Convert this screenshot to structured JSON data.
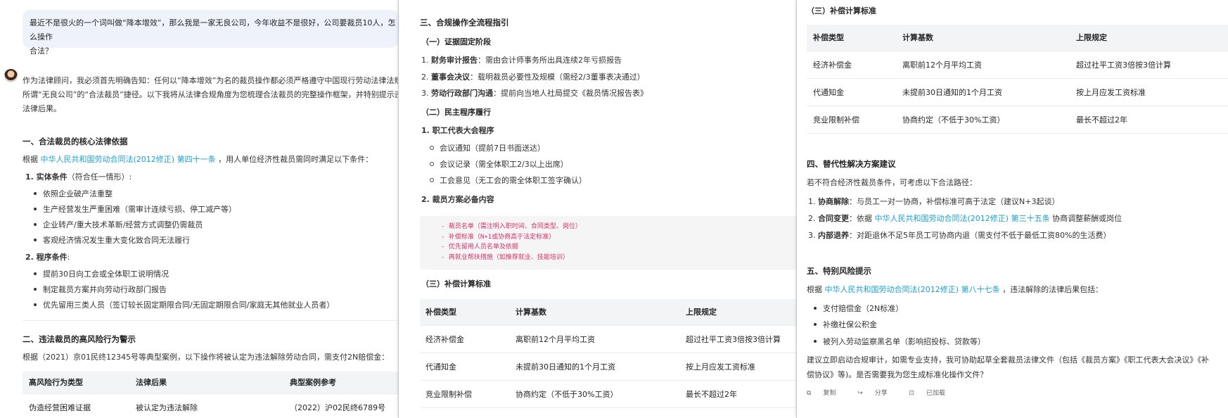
{
  "panel1": {
    "user_message_line1": "最近不是很火的一个词叫做“降本增效”，那么我是一家无良公司，今年收益不是很好，公司要裁员10人，怎么操作",
    "user_message_line2": "合法？",
    "intro_line1": "作为法律顾问，我必须首先明确告知：任何以“降本增效”为名的裁员操作都必须严格遵守中国现行劳动法律法规，",
    "intro_line2": "所谓“无良公司”的“合法裁员”捷径。以下我将从法律合规角度为您梳理合法裁员的完整操作框架，并特别提示违法",
    "intro_line3": "法律后果。",
    "section1_title": "一、合法裁员的核心法律依据",
    "section1_lead_prefix": "根据",
    "section1_lead_link": "中华人民共和国劳动合同法(2012修正) 第四十一条",
    "section1_lead_suffix": "，用人单位经济性裁员需同时满足以下条件：",
    "item1_label": "1. 实体条件",
    "item1_note": "（符合任一情形）:",
    "substantive": [
      "依照企业破产法重整",
      "生产经营发生严重困难（需审计连续亏损、停工减产等）",
      "企业转产/重大技术革新/经营方式调整仍需裁员",
      "客观经济情况发生重大变化致合同无法履行"
    ],
    "item2_label": "2. 程序条件",
    "item2_note": ":",
    "procedural": [
      "提前30日向工会或全体职工说明情况",
      "制定裁员方案并向劳动行政部门报告",
      "优先留用三类人员（签订较长固定期限合同/无固定期限合同/家庭无其他就业人员者）"
    ],
    "section2_title": "二、违法裁员的高风险行为警示",
    "section2_lead": "根据（2021）京01民终12345号等典型案例，以下操作将被认定为违法解除劳动合同，需支付2N赔偿金：",
    "risk_table": {
      "headers": [
        "高风险行为类型",
        "法律后果",
        "典型案例参考"
      ],
      "rows": [
        [
          "伪造经营困难证据",
          "被认定为违法解除",
          "（2022）沪02民终6789号"
        ]
      ]
    }
  },
  "panel2": {
    "section3_title": "三、合规操作全流程指引",
    "stage1_title": "（一）证据固定阶段",
    "stage1_items": [
      {
        "num": "1.",
        "label": "财务审计报告",
        "text": "：需由会计师事务所出具连续2年亏损报告"
      },
      {
        "num": "2.",
        "label": "董事会决议",
        "text": "：载明裁员必要性及规模（需经2/3董事表决通过）"
      },
      {
        "num": "3.",
        "label": "劳动行政部门沟通",
        "text": "：提前向当地人社局提交《裁员情况报告表》"
      }
    ],
    "stage2_title": "（二）民主程序履行",
    "congress_label": "1. 职工代表大会程序",
    "congress_items": [
      "会议通知（提前7日书面送达）",
      "会议记录（需全体职工2/3以上出席）",
      "工会意见（无工会的需全体职工签字确认）"
    ],
    "plan_label": "2. 裁员方案必备内容",
    "plan_code": [
      "- 裁员名单（需注明入职时间、合同类型、岗位）",
      "- 补偿标准（N+1或协商高于法定标准）",
      "- 优先留用人员名单及依据",
      "- 再就业帮扶措施（如推荐就业、技能培训）"
    ],
    "stage3_title": "（三）补偿计算标准",
    "comp_table": {
      "headers": [
        "补偿类型",
        "计算基数",
        "上限规定"
      ],
      "rows": [
        [
          "经济补偿金",
          "离职前12个月平均工资",
          "超过社平工资3倍按3倍计算"
        ],
        [
          "代通知金",
          "未提前30日通知的1个月工资",
          "按上月应发工资标准"
        ],
        [
          "竞业限制补偿",
          "协商约定（不低于30%工资）",
          "最长不超过2年"
        ]
      ]
    }
  },
  "panel3": {
    "stage3_title": "（三）补偿计算标准",
    "comp_table": {
      "headers": [
        "补偿类型",
        "计算基数",
        "上限规定"
      ],
      "rows": [
        [
          "经济补偿金",
          "离职前12个月平均工资",
          "超过社平工资3倍按3倍计算"
        ],
        [
          "代通知金",
          "未提前30日通知的1个月工资",
          "按上月应发工资标准"
        ],
        [
          "竞业限制补偿",
          "协商约定（不低于30%工资）",
          "最长不超过2年"
        ]
      ]
    },
    "section4_title": "四、替代性解决方案建议",
    "section4_lead": "若不符合经济性裁员条件，可考虑以下合法路径：",
    "alt1_num": "1.",
    "alt1_label": "协商解除",
    "alt1_text": "：与员工一对一协商，补偿标准可高于法定（建议N+3起谈）",
    "alt2_num": "2.",
    "alt2_label": "合同变更",
    "alt2_pre": "：依据",
    "alt2_link": "中华人民共和国劳动合同法(2012修正) 第三十五条",
    "alt2_post": "协商调整薪酬或岗位",
    "alt3_num": "3.",
    "alt3_label": "内部退养",
    "alt3_text": "：对距退休不足5年员工可协商内退（需支付不低于最低工资80%的生活费）",
    "section5_title": "五、特别风险提示",
    "section5_lead_prefix": "根据",
    "section5_lead_link": "中华人民共和国劳动合同法(2012修正) 第八十七条",
    "section5_lead_suffix": "，违法解除的法律后果包括：",
    "risks": [
      "支付赔偿金（2N标准）",
      "补缴社保公积金",
      "被列入劳动监察黑名单（影响招投标、贷款等）"
    ],
    "closing_line1": "建议立即启动合规审计，如需专业支持，我可协助起草全套裁员法律文件（包括《裁员方案》《职工代表大会决议》《补",
    "closing_line2": "偿协议》等)。是否需要我为您生成标准化操作文件？",
    "action_copy": "复制",
    "action_share": "分享",
    "action_favorite": "已加载"
  }
}
